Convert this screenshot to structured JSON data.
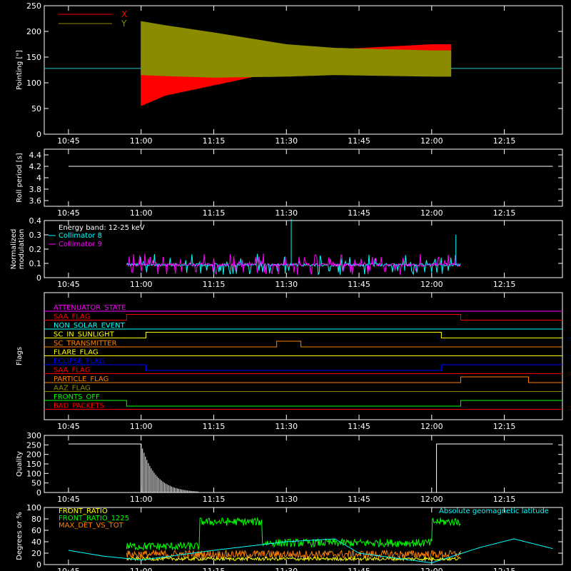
{
  "time_ticks": [
    "10:45",
    "11:00",
    "11:15",
    "11:30",
    "11:45",
    "12:00",
    "12:15"
  ],
  "chart_data": [
    {
      "id": "pointing",
      "type": "line",
      "ylabel": "Pointing [\"]",
      "ylim": [
        0,
        250
      ],
      "yticks": [
        0,
        50,
        100,
        150,
        200,
        250
      ],
      "legend": [
        {
          "name": "X",
          "color": "#ff0000"
        },
        {
          "name": "Y",
          "color": "#8b8b00"
        }
      ],
      "series": [
        {
          "name": "X",
          "color": "#ff0000",
          "x": [
            "11:00",
            "11:05",
            "11:15",
            "11:30",
            "11:40",
            "12:00",
            "12:04"
          ],
          "lower": [
            55,
            75,
            95,
            125,
            150,
            155,
            155
          ],
          "upper": [
            170,
            165,
            160,
            155,
            165,
            175,
            175
          ]
        },
        {
          "name": "Y",
          "color": "#8b8b00",
          "x": [
            "11:00",
            "11:05",
            "11:15",
            "11:30",
            "11:40",
            "12:00",
            "12:04"
          ],
          "lower": [
            115,
            113,
            110,
            112,
            115,
            112,
            112
          ],
          "upper": [
            220,
            212,
            198,
            175,
            168,
            163,
            163
          ]
        }
      ],
      "baseline": {
        "value": 128,
        "color": "#20c8c8"
      }
    },
    {
      "id": "roll",
      "type": "line",
      "ylabel": "Roll period [s]",
      "ylim": [
        3.5,
        4.5
      ],
      "yticks": [
        3.6,
        3.8,
        4.0,
        4.2,
        4.4
      ],
      "series": [
        {
          "name": "",
          "color": "#ffffff",
          "x": [
            "10:45",
            "12:25"
          ],
          "y": [
            4.2,
            4.2
          ]
        }
      ]
    },
    {
      "id": "modulation",
      "type": "line",
      "ylabel": [
        "Normalized",
        "modulation"
      ],
      "ylim": [
        0,
        0.4
      ],
      "yticks": [
        0.0,
        0.1,
        0.2,
        0.3,
        0.4
      ],
      "legend_title": "Energy band: 12-25 keV",
      "legend": [
        {
          "name": "Collimator 8",
          "color": "#00ffff"
        },
        {
          "name": "Collimator 9",
          "color": "#ff00ff"
        }
      ],
      "series": [
        {
          "name": "Collimator 8",
          "color": "#00ffff",
          "x_range": [
            "10:57",
            "12:06"
          ],
          "typical": 0.09
        },
        {
          "name": "Collimator 9",
          "color": "#ff00ff",
          "x_range": [
            "10:57",
            "12:06"
          ],
          "typical": 0.09
        }
      ],
      "spikes": [
        {
          "x": "11:31",
          "y": 0.41
        },
        {
          "x": "12:05",
          "y": 0.3
        }
      ]
    },
    {
      "id": "flags",
      "type": "line",
      "ylabel": "Flags",
      "flags": [
        {
          "name": "ATTENUATOR_STATE",
          "color": "#ff00ff",
          "steps": []
        },
        {
          "name": "SAA_FLAG",
          "color": "#ff0000",
          "steps": [
            [
              "10:57",
              "12:06",
              "high"
            ]
          ]
        },
        {
          "name": "NON_SOLAR_EVENT",
          "color": "#00ffff",
          "steps": []
        },
        {
          "name": "SC_IN_SUNLIGHT",
          "color": "#ffff00",
          "steps": [
            [
              "11:01",
              "12:02",
              "high"
            ]
          ]
        },
        {
          "name": "SC_TRANSMITTER",
          "color": "#ff8000",
          "steps": [
            [
              "11:28",
              "11:33",
              "high"
            ]
          ]
        },
        {
          "name": "FLARE_FLAG",
          "color": "#ffff00",
          "steps": []
        },
        {
          "name": "ECLIPSE_FLAG",
          "color": "#0000ff",
          "steps": [
            [
              "11:01",
              "12:02",
              "low"
            ]
          ]
        },
        {
          "name": "SAA_FLAG",
          "color": "#ff0000",
          "steps": []
        },
        {
          "name": "PARTICLE_FLAG",
          "color": "#ff8000",
          "steps": [
            [
              "12:06",
              "12:20",
              "high"
            ]
          ]
        },
        {
          "name": "AAZ_FLAG",
          "color": "#8b8b00",
          "steps": []
        },
        {
          "name": "FRONTS_OFF",
          "color": "#00ff00",
          "steps": [
            [
              "10:57",
              "12:06",
              "low"
            ]
          ]
        },
        {
          "name": "BAD_PACKETS",
          "color": "#ff0000",
          "steps": []
        }
      ]
    },
    {
      "id": "quality",
      "type": "line",
      "ylabel": "Quality",
      "ylim": [
        0,
        300
      ],
      "yticks": [
        0,
        50,
        100,
        150,
        200,
        250,
        300
      ],
      "series": [
        {
          "name": "",
          "color": "#ffffff",
          "x": [
            "10:45",
            "11:00",
            "11:00",
            "11:02",
            "12:01",
            "12:01",
            "12:25"
          ],
          "y": [
            255,
            255,
            0,
            0,
            0,
            255,
            255
          ]
        }
      ]
    },
    {
      "id": "front",
      "type": "line",
      "ylabel": "Degrees or %",
      "ylim": [
        0,
        100
      ],
      "yticks": [
        0,
        20,
        40,
        60,
        80,
        100
      ],
      "legend": [
        {
          "name": "FRONT_RATIO",
          "color": "#ffff00"
        },
        {
          "name": "FRONT_RATIO_1225",
          "color": "#00ff00"
        },
        {
          "name": "MAX_DET_VS_TOT",
          "color": "#ff8000"
        }
      ],
      "annotation": {
        "text": "Absolute geomagnetic latitude",
        "color": "#00ffff"
      },
      "series": [
        {
          "name": "FRONT_RATIO_1225",
          "color": "#00ff00",
          "x": [
            "10:57",
            "11:12",
            "11:12",
            "11:25",
            "11:25",
            "12:00",
            "12:00",
            "12:06"
          ],
          "y": [
            32,
            32,
            75,
            75,
            38,
            38,
            75,
            75
          ]
        },
        {
          "name": "MAX_DET_VS_TOT",
          "color": "#ff8000",
          "x": [
            "10:57",
            "12:06"
          ],
          "y": [
            18,
            18
          ]
        },
        {
          "name": "FRONT_RATIO",
          "color": "#ffff00",
          "x": [
            "10:57",
            "12:06"
          ],
          "y": [
            10,
            10
          ]
        },
        {
          "name": "Absolute geomagnetic latitude",
          "color": "#00ffff",
          "x": [
            "10:45",
            "10:52",
            "11:00",
            "11:15",
            "11:30",
            "11:40",
            "11:45",
            "12:00",
            "12:10",
            "12:17",
            "12:25"
          ],
          "y": [
            25,
            15,
            8,
            25,
            40,
            45,
            20,
            3,
            30,
            45,
            28
          ]
        }
      ]
    }
  ]
}
